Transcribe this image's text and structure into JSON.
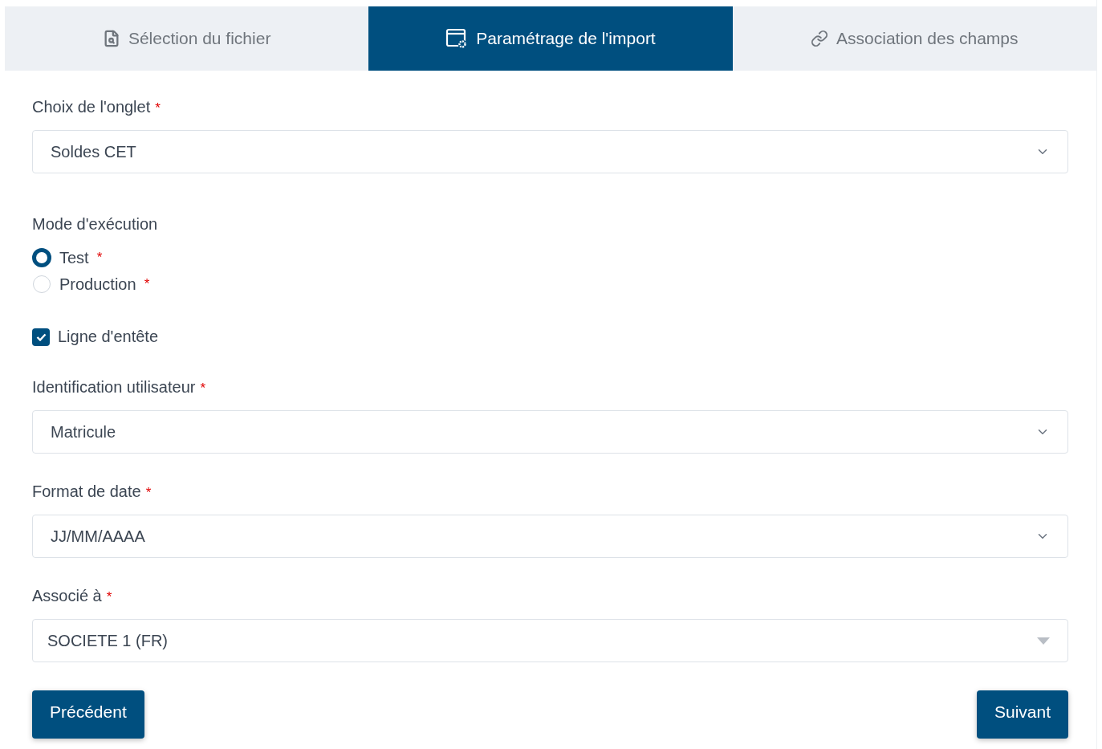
{
  "tabs": [
    {
      "label": "Sélection du fichier",
      "selected": false
    },
    {
      "label": "Paramétrage de l'import",
      "selected": true
    },
    {
      "label": "Association des champs",
      "selected": false
    }
  ],
  "fields": [
    {
      "kind": "select",
      "label": "Choix de l'onglet",
      "required_mark": "*",
      "value": "Soldes CET"
    },
    {
      "kind": "radio_group",
      "label": "Mode d'exécution",
      "options": [
        {
          "label": "Test",
          "required_mark": "*",
          "selected": true
        },
        {
          "label": "Production",
          "required_mark": "*",
          "selected": false
        }
      ]
    },
    {
      "kind": "checkbox",
      "label": "Ligne d'entête",
      "checked": true
    },
    {
      "kind": "select",
      "label": "Identification utilisateur",
      "required_mark": "*",
      "value": "Matricule"
    },
    {
      "kind": "select",
      "label": "Format de date",
      "required_mark": "*",
      "value": "JJ/MM/AAAA"
    },
    {
      "kind": "combobox",
      "label": "Associé à ",
      "required_mark": "*",
      "value": "SOCIETE 1 (FR)"
    }
  ],
  "buttons": [
    {
      "label": "Précédent"
    },
    {
      "label": "Suivant"
    }
  ]
}
